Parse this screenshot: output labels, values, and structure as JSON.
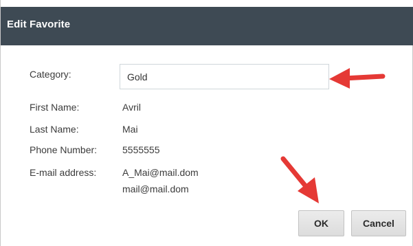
{
  "dialog": {
    "title": "Edit Favorite"
  },
  "form": {
    "category_label": "Category:",
    "category_value": "Gold",
    "first_name_label": "First Name:",
    "first_name_value": "Avril",
    "last_name_label": "Last Name:",
    "last_name_value": "Mai",
    "phone_label": "Phone Number:",
    "phone_value": "5555555",
    "email_label": "E-mail address:",
    "email_values": [
      "A_Mai@mail.dom",
      "mail@mail.dom"
    ]
  },
  "buttons": {
    "ok_label": "OK",
    "cancel_label": "Cancel"
  },
  "annotations": {
    "arrow_color": "#e53935",
    "arrow_icon_1": "red-arrow-icon",
    "arrow_icon_2": "red-arrow-icon"
  },
  "colors": {
    "titlebar": "#3e4a54"
  }
}
